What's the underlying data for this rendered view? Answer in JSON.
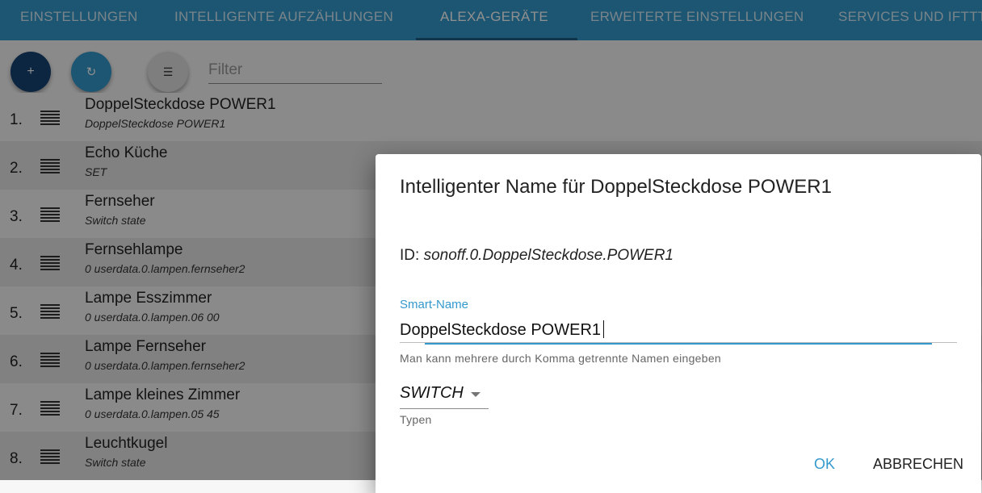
{
  "tabs": [
    {
      "label": "EINSTELLUNGEN",
      "active": false
    },
    {
      "label": "INTELLIGENTE AUFZÄHLUNGEN",
      "active": false
    },
    {
      "label": "ALEXA-GERÄTE",
      "active": true
    },
    {
      "label": "ERWEITERTE EINSTELLUNGEN",
      "active": false
    },
    {
      "label": "SERVICES UND IFTTT",
      "active": false
    }
  ],
  "toolbar": {
    "add_icon": "+",
    "refresh_icon": "↻",
    "list_icon": "☰",
    "filter_placeholder": "Filter"
  },
  "devices": [
    {
      "num": "1.",
      "name": "DoppelSteckdose POWER1",
      "sub": "DoppelSteckdose POWER1"
    },
    {
      "num": "2.",
      "name": "Echo Küche",
      "sub": "SET"
    },
    {
      "num": "3.",
      "name": "Fernseher",
      "sub": "Switch state"
    },
    {
      "num": "4.",
      "name": "Fernsehlampe",
      "sub": "0 userdata.0.lampen.fernseher2"
    },
    {
      "num": "5.",
      "name": "Lampe Esszimmer",
      "sub": "0 userdata.0.lampen.06 00"
    },
    {
      "num": "6.",
      "name": "Lampe Fernseher",
      "sub": "0 userdata.0.lampen.fernseher2"
    },
    {
      "num": "7.",
      "name": "Lampe kleines Zimmer",
      "sub": "0 userdata.0.lampen.05 45"
    },
    {
      "num": "8.",
      "name": "Leuchtkugel",
      "sub": "Switch state"
    }
  ],
  "dialog": {
    "title": "Intelligenter Name für DoppelSteckdose POWER1",
    "id_label": "ID:",
    "id_value": "sonoff.0.DoppelSteckdose.POWER1",
    "smart_name_label": "Smart-Name",
    "smart_name_value": "DoppelSteckdose POWER1",
    "helper_text": "Man kann mehrere durch Komma getrennte Namen eingeben",
    "type_value": "SWITCH",
    "type_label": "Typen",
    "ok_label": "OK",
    "cancel_label": "ABBRECHEN"
  },
  "colors": {
    "primary": "#3399cc",
    "dark_primary": "#164477"
  }
}
